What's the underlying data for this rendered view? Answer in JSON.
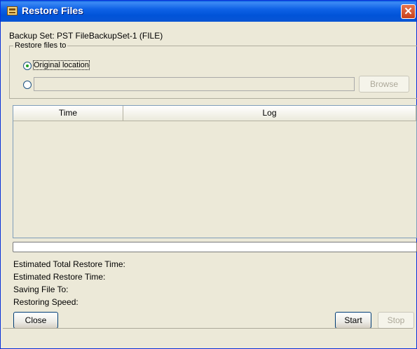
{
  "window": {
    "title": "Restore Files",
    "close_glyph": "✕"
  },
  "backup_set": "Backup Set: PST FileBackupSet-1 (FILE)",
  "restore_group": {
    "legend": "Restore files to",
    "original_label": "Original location",
    "original_selected": true,
    "alternate_path_value": "",
    "browse_label": "Browse"
  },
  "log_table": {
    "columns": [
      "Time",
      "Log"
    ],
    "rows": []
  },
  "progress": {
    "fraction": 0
  },
  "info": {
    "estimated_total": "Estimated Total Restore Time:",
    "estimated_restore": "Estimated Restore Time:",
    "saving_file_to": "Saving File To:",
    "restoring_speed": "Restoring Speed:"
  },
  "buttons": {
    "close": "Close",
    "start": "Start",
    "stop": "Stop"
  },
  "icons": {
    "app": "app-window-icon",
    "close": "close-icon"
  }
}
